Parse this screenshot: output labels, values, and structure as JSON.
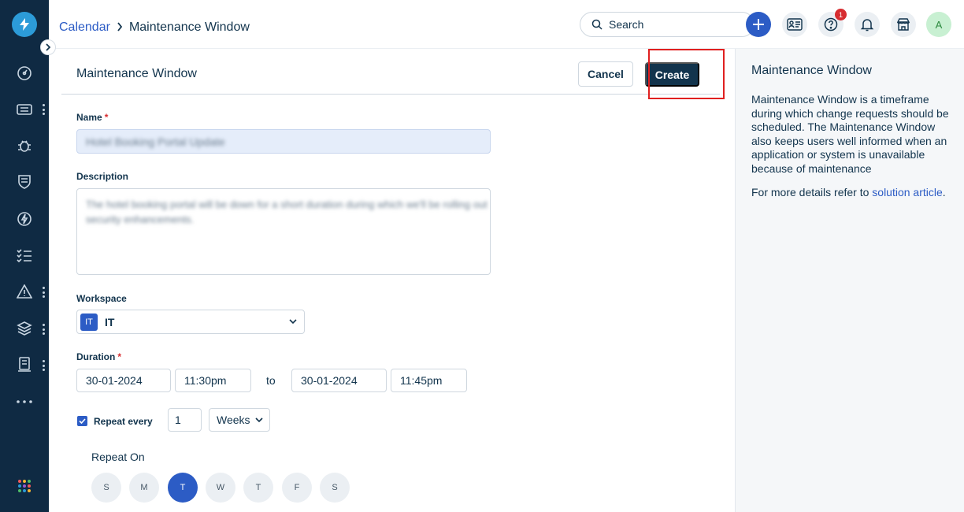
{
  "breadcrumb": {
    "parent": "Calendar",
    "current": "Maintenance Window"
  },
  "header": {
    "search_placeholder": "Search",
    "notification_count": "1",
    "avatar_initial": "A"
  },
  "form": {
    "title": "Maintenance Window",
    "cancel_label": "Cancel",
    "create_label": "Create",
    "name_label": "Name",
    "required_mark": "*",
    "name_value": "Hotel Booking Portal Update",
    "description_label": "Description",
    "description_value": "The hotel booking portal will be down for a short duration during which we'll be rolling out security enhancements.",
    "workspace_label": "Workspace",
    "workspace_badge": "IT",
    "workspace_value": "IT",
    "duration_label": "Duration",
    "start_date": "30-01-2024",
    "start_time": "11:30pm",
    "to_label": "to",
    "end_date": "30-01-2024",
    "end_time": "11:45pm",
    "repeat_label": "Repeat every",
    "repeat_checked": true,
    "repeat_count": "1",
    "repeat_unit": "Weeks",
    "repeat_on_label": "Repeat On",
    "days": [
      "S",
      "M",
      "T",
      "W",
      "T",
      "F",
      "S"
    ],
    "selected_day_index": 2
  },
  "side_panel": {
    "title": "Maintenance Window",
    "body": "Maintenance Window is a timeframe during which change requests should be scheduled. The Maintenance Window also keeps users well informed when an application or system is unavailable because of maintenance",
    "more_prefix": "For more details refer to ",
    "more_link": "solution article",
    "more_suffix": "."
  },
  "colors": {
    "nav_bg": "#0f2a43",
    "primary": "#2c5cc5",
    "dark_button": "#12344d",
    "highlight": "#e02020"
  }
}
